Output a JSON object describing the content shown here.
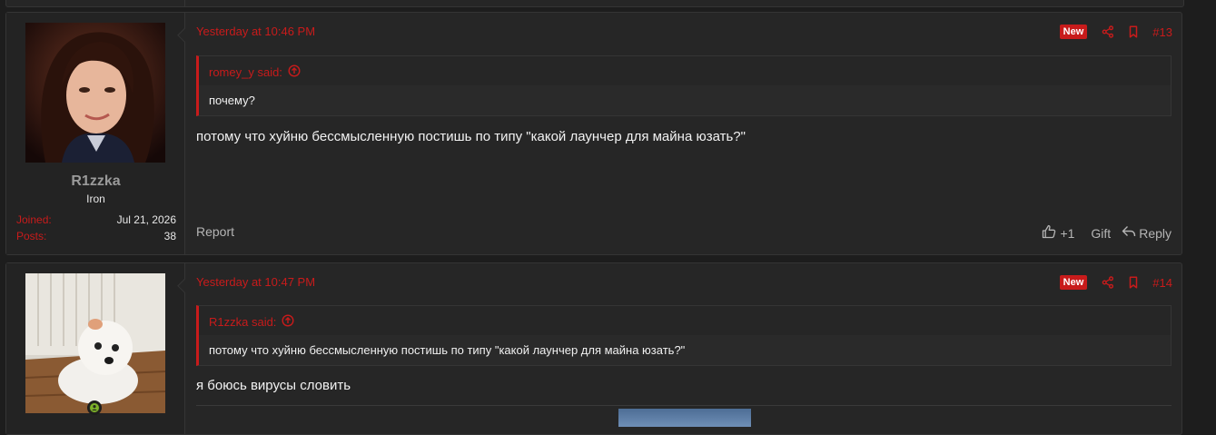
{
  "posts": [
    {
      "author": {
        "name": "R1zzka",
        "title": "Iron",
        "joined_label": "Joined:",
        "joined_value": "Jul 21, 2026",
        "posts_label": "Posts:",
        "posts_value": "38"
      },
      "date": "Yesterday at 10:46 PM",
      "badge": "New",
      "number": "#13",
      "quote": {
        "author": "romey_y said:",
        "text": "почему?"
      },
      "message": "потому что хуйню бессмысленную постишь по типу \"какой лаунчер для майна юзать?\"",
      "footer": {
        "report": "Report",
        "reaction_count": "+1",
        "gift": "Gift",
        "reply": "Reply"
      }
    },
    {
      "date": "Yesterday at 10:47 PM",
      "badge": "New",
      "number": "#14",
      "quote": {
        "author": "R1zzka said:",
        "text": "потому что хуйню бессмысленную постишь по типу \"какой лаунчер для майна юзать?\""
      },
      "message": "я боюсь вирусы словить"
    }
  ],
  "colors": {
    "accent": "#c81b1b",
    "background": "#1d1d1d",
    "panel": "#262626"
  },
  "icons": [
    "share-icon",
    "bookmark-icon",
    "arrow-up-circle-icon",
    "thumbs-up-icon",
    "reply-icon",
    "online-user-icon"
  ]
}
